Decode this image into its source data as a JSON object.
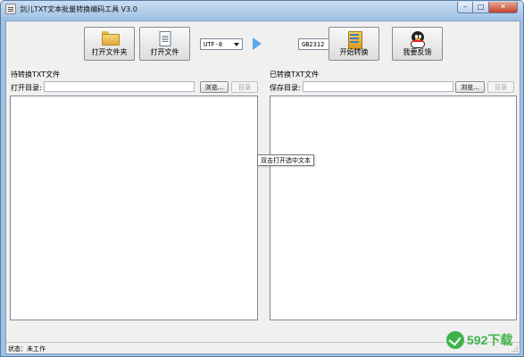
{
  "window": {
    "title": "剑儿TXT文本批量转换编码工具 V3.0",
    "caption_min": "–",
    "caption_max": "□",
    "caption_close": "✕"
  },
  "toolbar": {
    "open_folder_label": "打开文件夹",
    "open_file_label": "打开文件",
    "source_encoding": "UTF-8",
    "target_encoding": "GB2312",
    "convert_label": "开始转换",
    "feedback_label": "我要反馈"
  },
  "left_panel": {
    "heading": "待转换TXT文件",
    "dir_label": "打开目录:",
    "dir_value": "",
    "browse_label": "浏览...",
    "dir_button_label": "目录"
  },
  "right_panel": {
    "heading": "已转换TXT文件",
    "dir_label": "保存目录:",
    "dir_value": "",
    "browse_label": "浏览...",
    "dir_button_label": "目录"
  },
  "tooltip": "双击打开选中文本",
  "status": {
    "text": "状态：未工作"
  },
  "watermark": {
    "text": "592下载",
    "accent_color": "#45b54e"
  },
  "icons": {
    "app": "notepad-icon",
    "open_folder": "folder-icon",
    "open_file": "file-icon",
    "arrow": "play-arrow-icon",
    "convert": "convert-icon",
    "feedback": "qq-penguin-icon"
  }
}
